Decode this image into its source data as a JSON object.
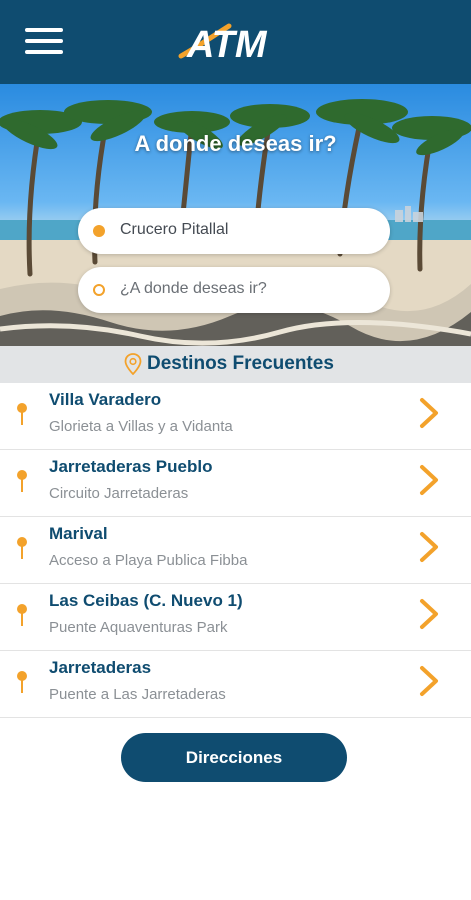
{
  "header": {
    "logo_text": "ATM",
    "background_color": "#0f4c70",
    "menu_icon": "hamburger-menu-icon"
  },
  "hero": {
    "title": "A donde deseas ir?",
    "origin": {
      "value": "Crucero Pitallal",
      "icon": "filled-dot-icon"
    },
    "destination": {
      "placeholder": "¿A donde deseas ir?",
      "icon": "hollow-dot-icon"
    }
  },
  "section": {
    "title": "Destinos Frecuentes",
    "icon": "location-pin-icon"
  },
  "destinations": [
    {
      "name": "Villa Varadero",
      "description": "Glorieta a Villas y a Vidanta"
    },
    {
      "name": "Jarretaderas Pueblo",
      "description": "Circuito Jarretaderas"
    },
    {
      "name": "Marival",
      "description": "Acceso a Playa Publica Fibba"
    },
    {
      "name": "Las Ceibas (C. Nuevo 1)",
      "description": "Puente Aquaventuras Park"
    },
    {
      "name": "Jarretaderas",
      "description": "Puente a Las Jarretaderas"
    }
  ],
  "directions_button": {
    "label": "Direcciones"
  },
  "colors": {
    "primary": "#0f4c70",
    "accent": "#f3a22b",
    "muted_text": "#8b9095",
    "section_bg": "#e2e4e6"
  }
}
